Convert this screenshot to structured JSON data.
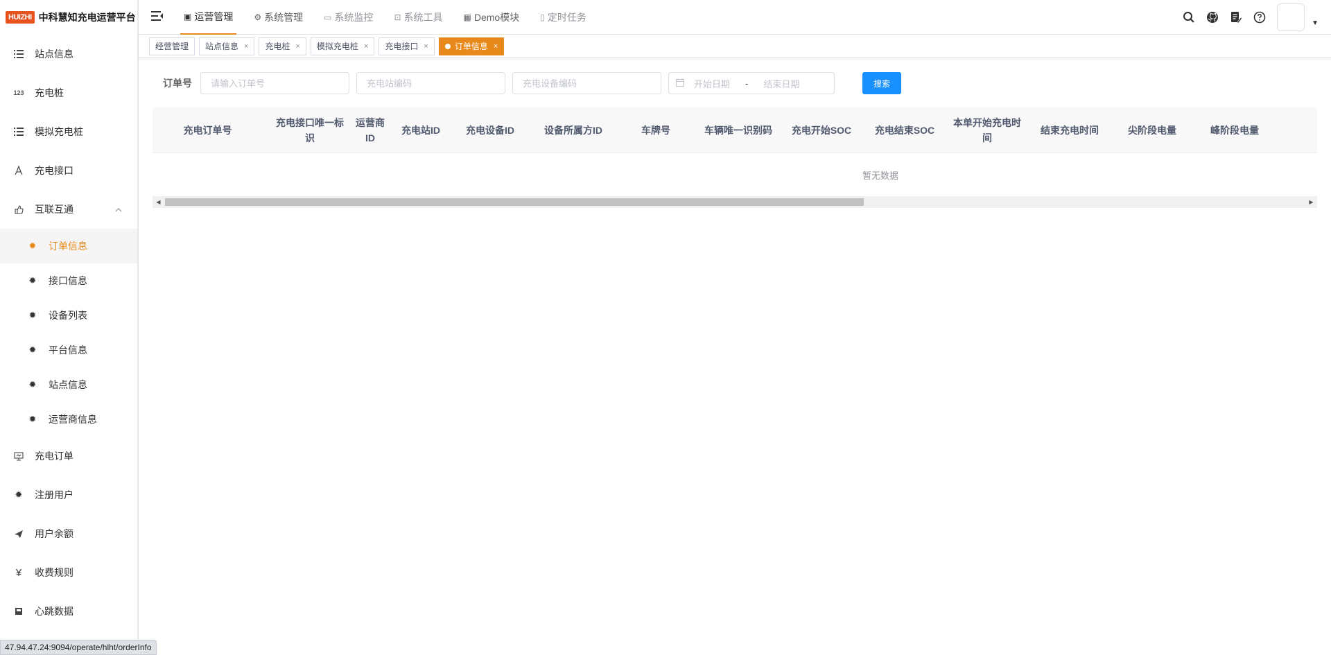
{
  "app": {
    "logo_text": "HUIZHI",
    "title": "中科慧知充电运营平台"
  },
  "sidebar": {
    "items": [
      {
        "label": "站点信息",
        "icon": "list-icon"
      },
      {
        "label": "充电桩",
        "icon": "number-icon"
      },
      {
        "label": "模拟充电桩",
        "icon": "list-icon"
      },
      {
        "label": "充电接口",
        "icon": "plug-icon"
      },
      {
        "label": "互联互通",
        "icon": "hand-icon",
        "expanded": true
      }
    ],
    "sub_items": [
      {
        "label": "订单信息",
        "active": true
      },
      {
        "label": "接口信息"
      },
      {
        "label": "设备列表"
      },
      {
        "label": "平台信息"
      },
      {
        "label": "站点信息"
      },
      {
        "label": "运营商信息"
      }
    ],
    "items_after": [
      {
        "label": "充电订单",
        "icon": "monitor-icon"
      },
      {
        "label": "注册用户",
        "icon": "bug-icon"
      },
      {
        "label": "用户余额",
        "icon": "send-icon"
      },
      {
        "label": "收费规则",
        "icon": "yen-icon"
      },
      {
        "label": "心跳数据",
        "icon": "chip-icon"
      }
    ]
  },
  "topnav": [
    {
      "label": "运营管理",
      "active": true
    },
    {
      "label": "系统管理"
    },
    {
      "label": "系统监控"
    },
    {
      "label": "系统工具"
    },
    {
      "label": "Demo模块"
    },
    {
      "label": "定时任务"
    }
  ],
  "tags": [
    {
      "label": "经营管理",
      "closable": false
    },
    {
      "label": "站点信息",
      "closable": true
    },
    {
      "label": "充电桩",
      "closable": true
    },
    {
      "label": "模拟充电桩",
      "closable": true
    },
    {
      "label": "充电接口",
      "closable": true
    },
    {
      "label": "订单信息",
      "closable": true,
      "active": true
    }
  ],
  "search": {
    "order_label": "订单号",
    "order_placeholder": "请输入订单号",
    "station_placeholder": "充电站编码",
    "device_placeholder": "充电设备编码",
    "start_date": "开始日期",
    "date_sep": "-",
    "end_date": "结束日期",
    "search_button": "搜索"
  },
  "table": {
    "columns": [
      "充电订单号",
      "充电接口唯一标识",
      "运营商ID",
      "充电站ID",
      "充电设备ID",
      "设备所属方ID",
      "车牌号",
      "车辆唯一识别码",
      "充电开始SOC",
      "充电结束SOC",
      "本单开始充电时间",
      "结束充电时间",
      "尖阶段电量",
      "峰阶段电量"
    ],
    "empty_text": "暂无数据"
  },
  "status_url": "47.94.47.24:9094/operate/hlht/orderInfo",
  "colors": {
    "accent": "#e8891b",
    "primary": "#1890ff",
    "logo": "#e8521f"
  }
}
